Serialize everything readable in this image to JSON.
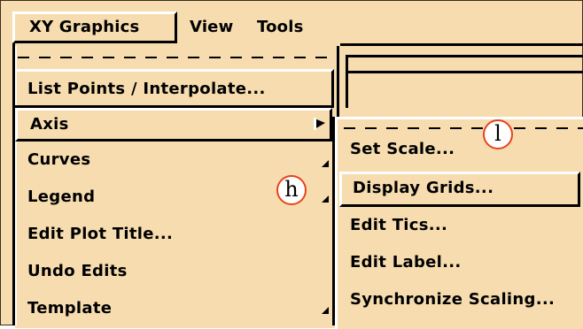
{
  "menubar": {
    "items": [
      "XY Graphics",
      "View",
      "Tools"
    ]
  },
  "main_menu": {
    "items": [
      {
        "label": "List Points / Interpolate..."
      },
      {
        "label": "Axis"
      },
      {
        "label": "Curves"
      },
      {
        "label": "Legend"
      },
      {
        "label": "Edit Plot Title..."
      },
      {
        "label": "Undo Edits"
      },
      {
        "label": "Template"
      }
    ]
  },
  "submenu": {
    "items": [
      {
        "label": "Set Scale..."
      },
      {
        "label": "Display Grids..."
      },
      {
        "label": "Edit Tics..."
      },
      {
        "label": "Edit Label..."
      },
      {
        "label": "Synchronize Scaling..."
      }
    ]
  },
  "callouts": {
    "l": "l",
    "h": "h"
  },
  "colors": {
    "menu_bg": "#f6dcaf",
    "highlight_light": "#ffffff",
    "highlight_dark": "#000000",
    "callout_border": "#e8431b"
  }
}
